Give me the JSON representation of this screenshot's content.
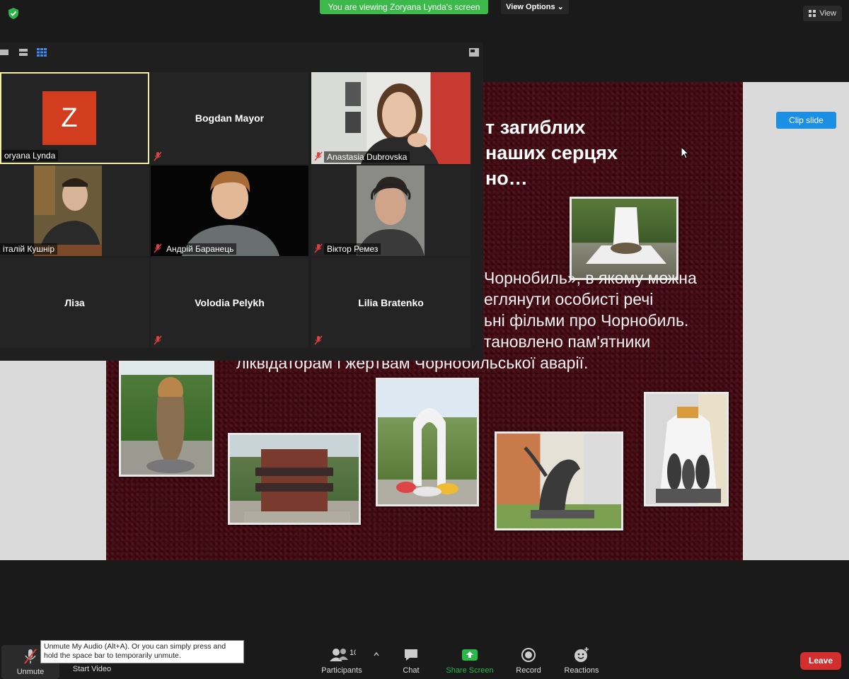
{
  "top_bar": {
    "viewing_banner": "You are viewing Zoryana Lynda's screen",
    "view_options": "View Options ⌄",
    "view_button": "View"
  },
  "slide": {
    "title_lines": "т загиблих\nнаших серцях\nно…",
    "body_lines": "Чорнобиль», в якому можна\nеглянути особисті речі\nьні фільми про Чорнобиль.\nтановлено пам'ятники",
    "body_last": "ліквідаторам і жертвам Чорнобильської аварії.",
    "clip_slide": "Clip slide"
  },
  "gallery": {
    "tiles": [
      {
        "name": "oryana Lynda",
        "avatar": "Z"
      },
      {
        "name": "Bogdan Mayor"
      },
      {
        "name": "Anastasia Dubrovska"
      },
      {
        "name": "італій Кушнір"
      },
      {
        "name": "Андрій Баранець"
      },
      {
        "name": "Віктор Ремез"
      },
      {
        "name": "Ліза"
      },
      {
        "name": "Volodia Pelykh"
      },
      {
        "name": "Lilia Bratenko"
      }
    ]
  },
  "toolbar": {
    "unmute": "Unmute",
    "start_video": "Start Video",
    "participants": "Participants",
    "participants_count": "10",
    "chat": "Chat",
    "share_screen": "Share Screen",
    "record": "Record",
    "reactions": "Reactions",
    "leave": "Leave",
    "tooltip": "Unmute My Audio (Alt+A). Or you can simply press and hold the space bar to temporarily unmute."
  },
  "colors": {
    "banner_green": "#3cb94a",
    "slide_maroon": "#44101a",
    "clip_blue": "#1a8fe3",
    "leave_red": "#d32f2f",
    "share_green": "#29b84a"
  }
}
